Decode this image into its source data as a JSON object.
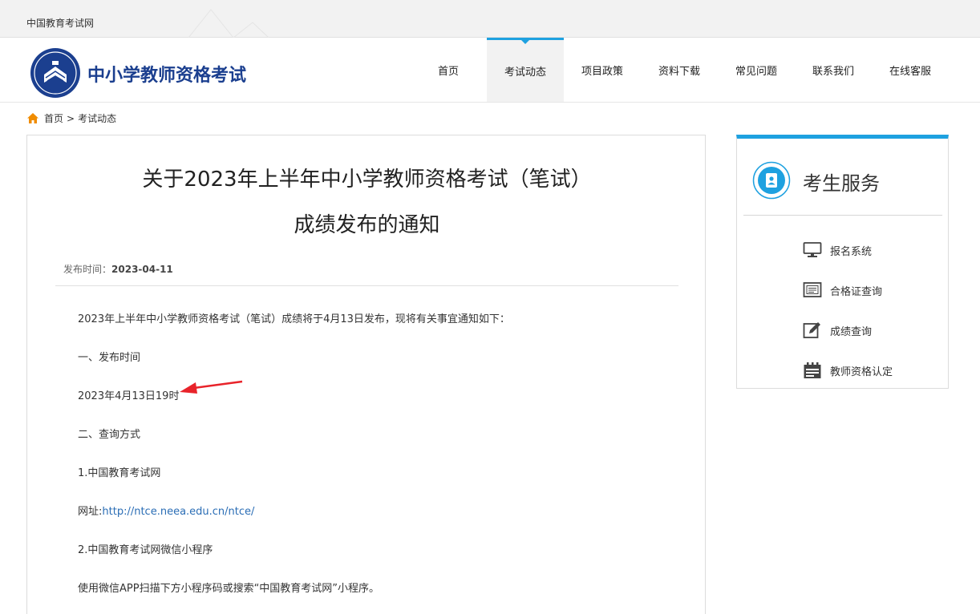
{
  "topbar": {
    "site_name": "中国教育考试网"
  },
  "header": {
    "brand": "中小学教师资格考试",
    "nav": [
      {
        "label": "首页",
        "active": false
      },
      {
        "label": "考试动态",
        "active": true
      },
      {
        "label": "项目政策",
        "active": false
      },
      {
        "label": "资料下载",
        "active": false
      },
      {
        "label": "常见问题",
        "active": false
      },
      {
        "label": "联系我们",
        "active": false
      },
      {
        "label": "在线客服",
        "active": false
      }
    ]
  },
  "breadcrumb": {
    "home": "首页",
    "separator": ">",
    "current": "考试动态"
  },
  "article": {
    "title_line1": "关于2023年上半年中小学教师资格考试（笔试）",
    "title_line2": "成绩发布的通知",
    "publish_label": "发布时间：",
    "publish_date": "2023-04-11",
    "paragraphs": [
      "2023年上半年中小学教师资格考试（笔试）成绩将于4月13日发布，现将有关事宜通知如下：",
      "一、发布时间",
      "2023年4月13日19时",
      "二、查询方式",
      "1.中国教育考试网",
      "网址:",
      "2.中国教育考试网微信小程序",
      "使用微信APP扫描下方小程序码或搜索“中国教育考试网”小程序。"
    ],
    "url": "http://ntce.neea.edu.cn/ntce/"
  },
  "sidebar": {
    "title": "考生服务",
    "items": [
      {
        "label": "报名系统",
        "icon": "monitor-icon"
      },
      {
        "label": "合格证查询",
        "icon": "certificate-icon"
      },
      {
        "label": "成绩查询",
        "icon": "edit-icon"
      },
      {
        "label": "教师资格认定",
        "icon": "calendar-icon"
      }
    ]
  },
  "colors": {
    "accent": "#1ea1e0",
    "brand": "#1b3f8f",
    "annotation_arrow": "#e8232a"
  }
}
